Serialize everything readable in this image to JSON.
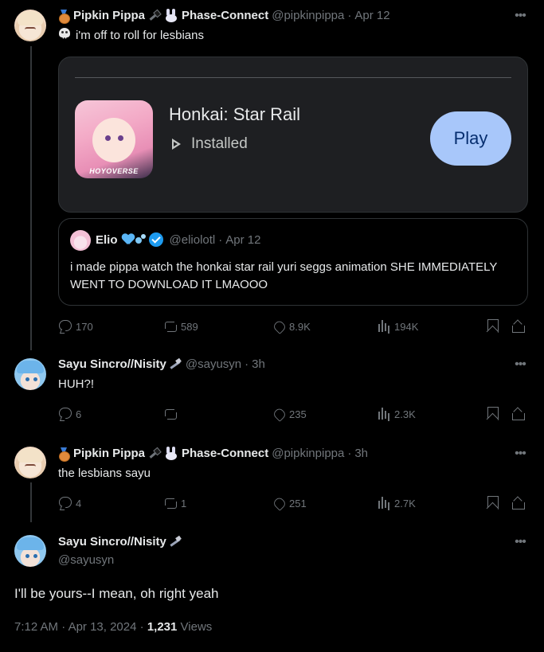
{
  "tweets": [
    {
      "name": "Pipkin Pippa",
      "org": "Phase-Connect",
      "handle": "@pipkinpippa",
      "sep": "·",
      "time": "Apr 12",
      "text": "i'm off to roll for lesbians",
      "media": {
        "app_title": "Honkai: Star Rail",
        "status": "Installed",
        "play_label": "Play",
        "icon_label": "HOYOVERSE"
      },
      "quote": {
        "name": "Elio",
        "handle": "@eliolotl",
        "time": "Apr 12",
        "text": "i made pippa watch the honkai star rail yuri seggs animation SHE IMMEDIATELY WENT TO DOWNLOAD IT LMAOOO"
      },
      "actions": {
        "replies": "170",
        "reposts": "589",
        "likes": "8.9K",
        "views": "194K"
      }
    },
    {
      "name": "Sayu Sincro//Nisity",
      "handle": "@sayusyn",
      "sep": "·",
      "time": "3h",
      "text": "HUH?!",
      "actions": {
        "replies": "6",
        "reposts": "",
        "likes": "235",
        "views": "2.3K"
      }
    },
    {
      "name": "Pipkin Pippa",
      "org": "Phase-Connect",
      "handle": "@pipkinpippa",
      "sep": "·",
      "time": "3h",
      "text": "the lesbians sayu",
      "actions": {
        "replies": "4",
        "reposts": "1",
        "likes": "251",
        "views": "2.7K"
      }
    }
  ],
  "main_tweet": {
    "name": "Sayu Sincro//Nisity",
    "handle": "@sayusyn",
    "text": "I'll be yours--I mean, oh right yeah",
    "time": "7:12 AM",
    "date": "Apr 13, 2024",
    "views_count": "1,231",
    "views_label": "Views",
    "sep": "·"
  },
  "colors": {
    "background": "#000000",
    "text": "#e7e9ea",
    "muted": "#71767b",
    "play_button": "#a8c7fa",
    "verified": "#1d9bf0"
  },
  "icons": [
    "medal-icon",
    "plug-icon",
    "bunny-icon",
    "skull-icon",
    "wrench-icon",
    "heart-icon",
    "bubbles-icon",
    "verified-icon",
    "more-icon",
    "reply-icon",
    "repost-icon",
    "like-icon",
    "views-icon",
    "bookmark-icon",
    "share-icon",
    "installed-icon"
  ]
}
